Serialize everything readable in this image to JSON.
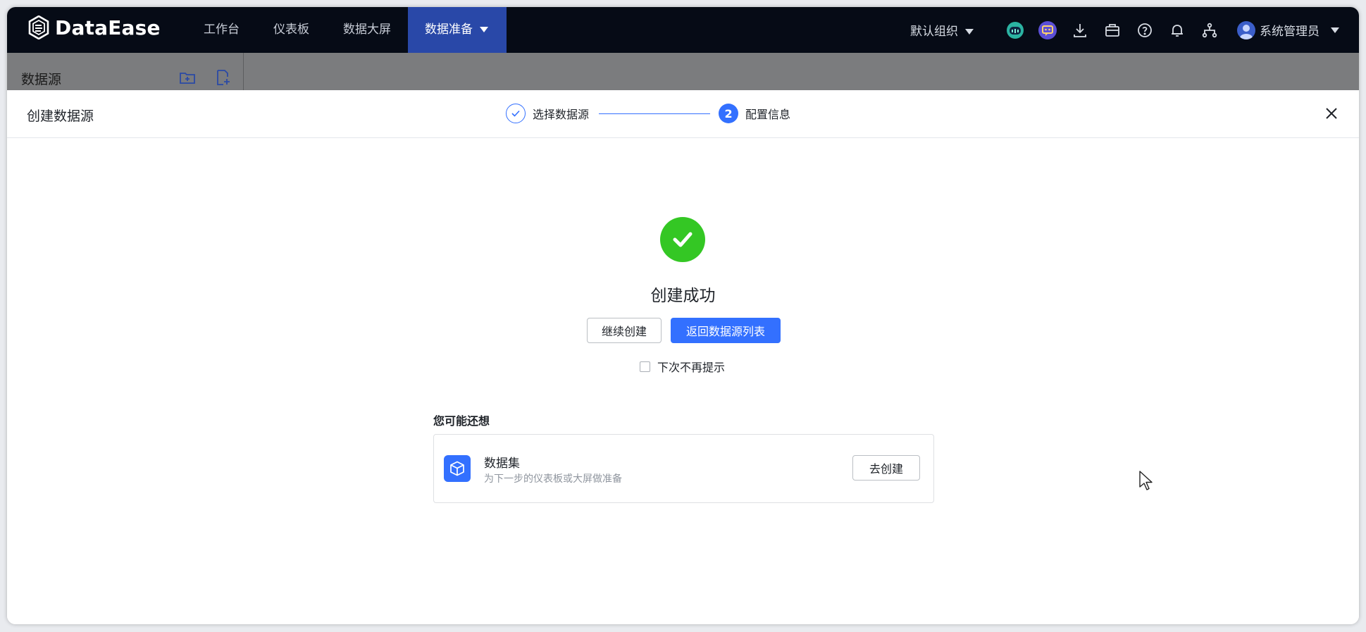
{
  "app": {
    "logo_text": "DataEase"
  },
  "nav": {
    "items": [
      {
        "label": "工作台"
      },
      {
        "label": "仪表板"
      },
      {
        "label": "数据大屏"
      },
      {
        "label": "数据准备"
      }
    ]
  },
  "header_right": {
    "org_label": "默认组织",
    "user_name": "系统管理员"
  },
  "page": {
    "sidebar_title": "数据源"
  },
  "drawer": {
    "title": "创建数据源",
    "steps": [
      {
        "label": "选择数据源",
        "state": "done"
      },
      {
        "number": "2",
        "label": "配置信息",
        "state": "current"
      }
    ],
    "success_title": "创建成功",
    "continue_label": "继续创建",
    "back_label": "返回数据源列表",
    "dont_remind_label": "下次不再提示",
    "also_title": "您可能还想",
    "card": {
      "name": "数据集",
      "desc": "为下一步的仪表板或大屏做准备",
      "button_label": "去创建"
    }
  },
  "colors": {
    "topbar_bg": "#060b16",
    "nav_active_bg": "#2948a8",
    "primary": "#3370ff",
    "success": "#34c724",
    "overlay_strip": "#7b7c7e"
  },
  "icons": [
    "dataease-logo-icon",
    "caret-down-icon",
    "ai-robot-icon",
    "chat-bot-icon",
    "download-icon",
    "briefcase-icon",
    "help-icon",
    "bell-icon",
    "org-tree-icon",
    "user-avatar-icon",
    "new-folder-icon",
    "new-file-icon",
    "check-icon",
    "close-icon",
    "cube-icon",
    "mouse-cursor-icon"
  ]
}
